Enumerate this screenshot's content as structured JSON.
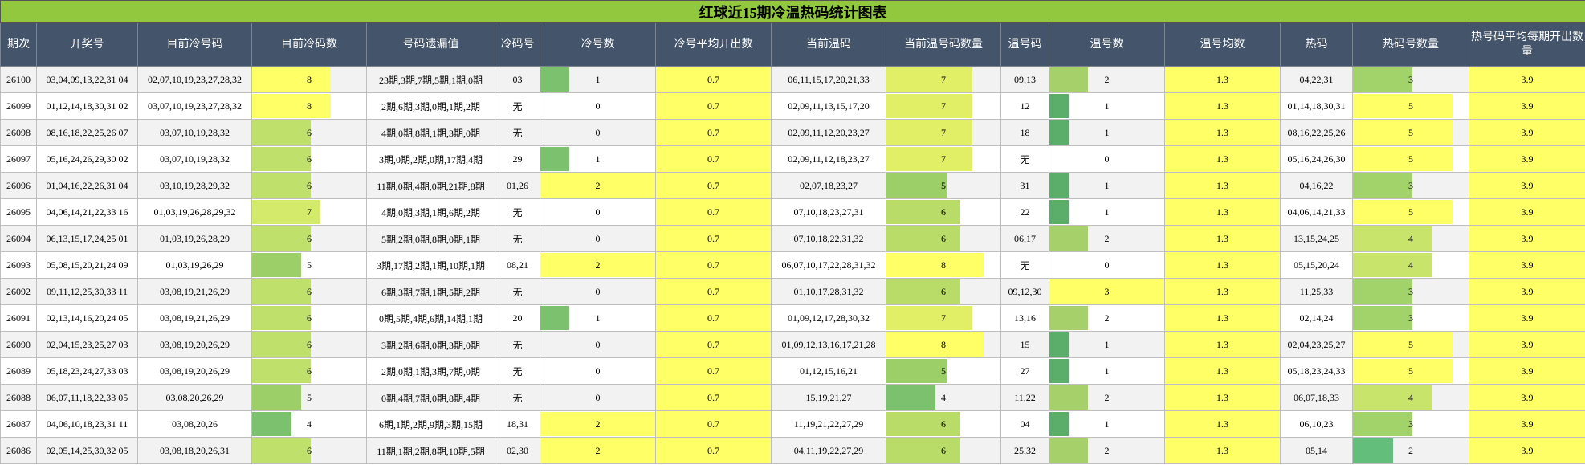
{
  "title": "红球近15期冷温热码统计图表",
  "headers": [
    "期次",
    "开奖号",
    "目前冷号码",
    "目前冷码数",
    "号码遗漏值",
    "冷码号",
    "冷号数",
    "冷号平均开出数",
    "当前温码",
    "当前温号码数量",
    "温号码",
    "温号数",
    "温号均数",
    "热码",
    "热码号数量",
    "热号码平均每期开出数量"
  ],
  "colors": {
    "title_bg": "#92c83e",
    "header_bg": "#44546a",
    "highlight_yellow": "#ffff66",
    "bar_scale": [
      "#63be7b",
      "#ffeb84"
    ]
  },
  "rows": [
    {
      "period": "26100",
      "draw": "03,04,09,13,22,31 04",
      "cold_numbers": "02,07,10,19,23,27,28,32",
      "cold_count": "8",
      "omission": "23期,3期,7期,5期,1期,0期",
      "cold_code": "03",
      "cold_num": "1",
      "cold_avg": "0.7",
      "warm_numbers": "06,11,15,17,20,21,33",
      "warm_count": "7",
      "warm_code": "09,13",
      "warm_num": "2",
      "warm_avg": "1.3",
      "hot_numbers": "04,22,31",
      "hot_count": "3",
      "hot_avg": "3.9"
    },
    {
      "period": "26099",
      "draw": "01,12,14,18,30,31 02",
      "cold_numbers": "03,07,10,19,23,27,28,32",
      "cold_count": "8",
      "omission": "2期,6期,3期,0期,1期,2期",
      "cold_code": "无",
      "cold_num": "0",
      "cold_avg": "0.7",
      "warm_numbers": "02,09,11,13,15,17,20",
      "warm_count": "7",
      "warm_code": "12",
      "warm_num": "1",
      "warm_avg": "1.3",
      "hot_numbers": "01,14,18,30,31",
      "hot_count": "5",
      "hot_avg": "3.9"
    },
    {
      "period": "26098",
      "draw": "08,16,18,22,25,26 07",
      "cold_numbers": "03,07,10,19,28,32",
      "cold_count": "6",
      "omission": "4期,0期,8期,1期,3期,0期",
      "cold_code": "无",
      "cold_num": "0",
      "cold_avg": "0.7",
      "warm_numbers": "02,09,11,12,20,23,27",
      "warm_count": "7",
      "warm_code": "18",
      "warm_num": "1",
      "warm_avg": "1.3",
      "hot_numbers": "08,16,22,25,26",
      "hot_count": "5",
      "hot_avg": "3.9"
    },
    {
      "period": "26097",
      "draw": "05,16,24,26,29,30 02",
      "cold_numbers": "03,07,10,19,28,32",
      "cold_count": "6",
      "omission": "3期,0期,2期,0期,17期,4期",
      "cold_code": "29",
      "cold_num": "1",
      "cold_avg": "0.7",
      "warm_numbers": "02,09,11,12,18,23,27",
      "warm_count": "7",
      "warm_code": "无",
      "warm_num": "0",
      "warm_avg": "1.3",
      "hot_numbers": "05,16,24,26,30",
      "hot_count": "5",
      "hot_avg": "3.9"
    },
    {
      "period": "26096",
      "draw": "01,04,16,22,26,31 04",
      "cold_numbers": "03,10,19,28,29,32",
      "cold_count": "6",
      "omission": "11期,0期,4期,0期,21期,8期",
      "cold_code": "01,26",
      "cold_num": "2",
      "cold_avg": "0.7",
      "warm_numbers": "02,07,18,23,27",
      "warm_count": "5",
      "warm_code": "31",
      "warm_num": "1",
      "warm_avg": "1.3",
      "hot_numbers": "04,16,22",
      "hot_count": "3",
      "hot_avg": "3.9"
    },
    {
      "period": "26095",
      "draw": "04,06,14,21,22,33 16",
      "cold_numbers": "01,03,19,26,28,29,32",
      "cold_count": "7",
      "omission": "4期,0期,3期,1期,6期,2期",
      "cold_code": "无",
      "cold_num": "0",
      "cold_avg": "0.7",
      "warm_numbers": "07,10,18,23,27,31",
      "warm_count": "6",
      "warm_code": "22",
      "warm_num": "1",
      "warm_avg": "1.3",
      "hot_numbers": "04,06,14,21,33",
      "hot_count": "5",
      "hot_avg": "3.9"
    },
    {
      "period": "26094",
      "draw": "06,13,15,17,24,25 01",
      "cold_numbers": "01,03,19,26,28,29",
      "cold_count": "6",
      "omission": "5期,2期,0期,8期,0期,1期",
      "cold_code": "无",
      "cold_num": "0",
      "cold_avg": "0.7",
      "warm_numbers": "07,10,18,22,31,32",
      "warm_count": "6",
      "warm_code": "06,17",
      "warm_num": "2",
      "warm_avg": "1.3",
      "hot_numbers": "13,15,24,25",
      "hot_count": "4",
      "hot_avg": "3.9"
    },
    {
      "period": "26093",
      "draw": "05,08,15,20,21,24 09",
      "cold_numbers": "01,03,19,26,29",
      "cold_count": "5",
      "omission": "3期,17期,2期,1期,10期,1期",
      "cold_code": "08,21",
      "cold_num": "2",
      "cold_avg": "0.7",
      "warm_numbers": "06,07,10,17,22,28,31,32",
      "warm_count": "8",
      "warm_code": "无",
      "warm_num": "0",
      "warm_avg": "1.3",
      "hot_numbers": "05,15,20,24",
      "hot_count": "4",
      "hot_avg": "3.9"
    },
    {
      "period": "26092",
      "draw": "09,11,12,25,30,33 11",
      "cold_numbers": "03,08,19,21,26,29",
      "cold_count": "6",
      "omission": "6期,3期,7期,1期,5期,2期",
      "cold_code": "无",
      "cold_num": "0",
      "cold_avg": "0.7",
      "warm_numbers": "01,10,17,28,31,32",
      "warm_count": "6",
      "warm_code": "09,12,30",
      "warm_num": "3",
      "warm_avg": "1.3",
      "hot_numbers": "11,25,33",
      "hot_count": "3",
      "hot_avg": "3.9"
    },
    {
      "period": "26091",
      "draw": "02,13,14,16,20,24 05",
      "cold_numbers": "03,08,19,21,26,29",
      "cold_count": "6",
      "omission": "0期,5期,4期,6期,14期,1期",
      "cold_code": "20",
      "cold_num": "1",
      "cold_avg": "0.7",
      "warm_numbers": "01,09,12,17,28,30,32",
      "warm_count": "7",
      "warm_code": "13,16",
      "warm_num": "2",
      "warm_avg": "1.3",
      "hot_numbers": "02,14,24",
      "hot_count": "3",
      "hot_avg": "3.9"
    },
    {
      "period": "26090",
      "draw": "02,04,15,23,25,27 03",
      "cold_numbers": "03,08,19,20,26,29",
      "cold_count": "6",
      "omission": "3期,2期,6期,0期,3期,0期",
      "cold_code": "无",
      "cold_num": "0",
      "cold_avg": "0.7",
      "warm_numbers": "01,09,12,13,16,17,21,28",
      "warm_count": "8",
      "warm_code": "15",
      "warm_num": "1",
      "warm_avg": "1.3",
      "hot_numbers": "02,04,23,25,27",
      "hot_count": "5",
      "hot_avg": "3.9"
    },
    {
      "period": "26089",
      "draw": "05,18,23,24,27,33 03",
      "cold_numbers": "03,08,19,20,26,29",
      "cold_count": "6",
      "omission": "2期,0期,1期,3期,7期,0期",
      "cold_code": "无",
      "cold_num": "0",
      "cold_avg": "0.7",
      "warm_numbers": "01,12,15,16,21",
      "warm_count": "5",
      "warm_code": "27",
      "warm_num": "1",
      "warm_avg": "1.3",
      "hot_numbers": "05,18,23,24,33",
      "hot_count": "5",
      "hot_avg": "3.9"
    },
    {
      "period": "26088",
      "draw": "06,07,11,18,22,33 05",
      "cold_numbers": "03,08,20,26,29",
      "cold_count": "5",
      "omission": "0期,4期,7期,0期,8期,4期",
      "cold_code": "无",
      "cold_num": "0",
      "cold_avg": "0.7",
      "warm_numbers": "15,19,21,27",
      "warm_count": "4",
      "warm_code": "11,22",
      "warm_num": "2",
      "warm_avg": "1.3",
      "hot_numbers": "06,07,18,33",
      "hot_count": "4",
      "hot_avg": "3.9"
    },
    {
      "period": "26087",
      "draw": "04,06,10,18,23,31 11",
      "cold_numbers": "03,08,20,26",
      "cold_count": "4",
      "omission": "6期,1期,2期,9期,3期,15期",
      "cold_code": "18,31",
      "cold_num": "2",
      "cold_avg": "0.7",
      "warm_numbers": "11,19,21,22,27,29",
      "warm_count": "6",
      "warm_code": "04",
      "warm_num": "1",
      "warm_avg": "1.3",
      "hot_numbers": "06,10,23",
      "hot_count": "3",
      "hot_avg": "3.9"
    },
    {
      "period": "26086",
      "draw": "02,05,14,25,30,32 05",
      "cold_numbers": "03,08,18,20,26,31",
      "cold_count": "6",
      "omission": "11期,1期,2期,8期,10期,5期",
      "cold_code": "02,30",
      "cold_num": "2",
      "cold_avg": "0.7",
      "warm_numbers": "04,11,19,22,27,29",
      "warm_count": "6",
      "warm_code": "25,32",
      "warm_num": "2",
      "warm_avg": "1.3",
      "hot_numbers": "05,14",
      "hot_count": "2",
      "hot_avg": "3.9"
    }
  ]
}
